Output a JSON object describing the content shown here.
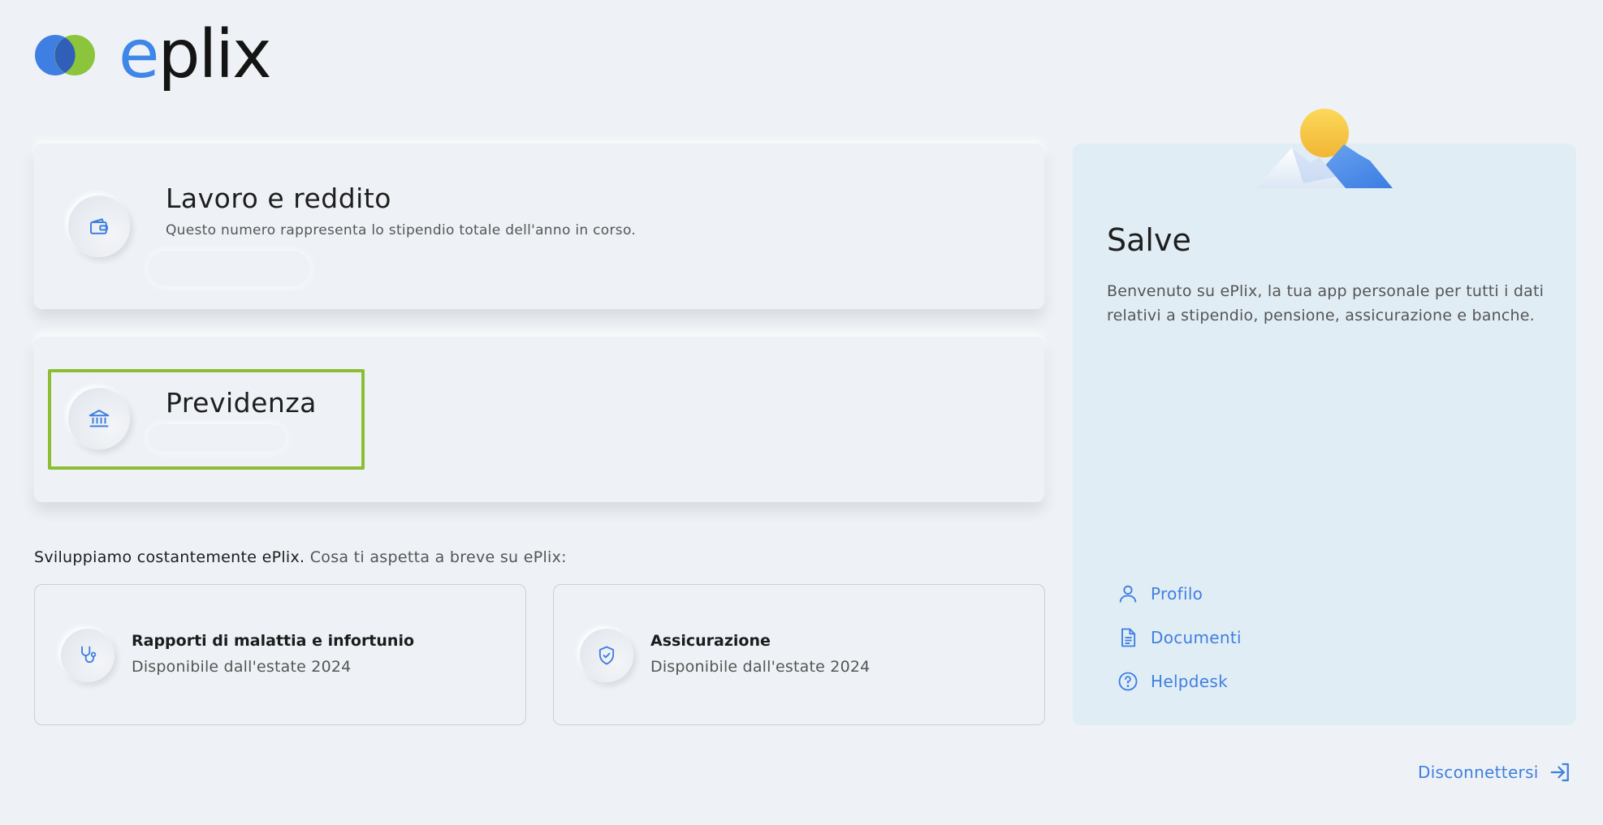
{
  "brand": {
    "name_first": "e",
    "name_rest": "plix",
    "accent": "#3e86e8",
    "green": "#8cbe34"
  },
  "cards": {
    "work": {
      "icon": "wallet-icon",
      "title": "Lavoro e reddito",
      "subtitle": "Questo numero rappresenta lo stipendio totale dell'anno in corso."
    },
    "pension": {
      "icon": "bank-icon",
      "title": "Previdenza"
    }
  },
  "coming_soon": {
    "lead_strong": "Sviluppiamo costantemente ePlix.",
    "lead_soft": " Cosa ti aspetta a breve su ePlix:",
    "items": [
      {
        "icon": "stethoscope-icon",
        "title": "Rapporti di malattia e infortunio",
        "subtitle": "Disponibile dall'estate 2024"
      },
      {
        "icon": "shield-check-icon",
        "title": "Assicurazione",
        "subtitle": "Disponibile dall'estate 2024"
      }
    ]
  },
  "panel": {
    "title": "Salve",
    "text": "Benvenuto su ePlix, la tua app personale per tutti i dati relativi a stipendio, pensione, assicurazione e banche.",
    "links": [
      {
        "icon": "user-icon",
        "label": "Profilo"
      },
      {
        "icon": "document-icon",
        "label": "Documenti"
      },
      {
        "icon": "help-icon",
        "label": "Helpdesk"
      }
    ]
  },
  "logout": {
    "label": "Disconnettersi",
    "icon": "logout-icon"
  }
}
